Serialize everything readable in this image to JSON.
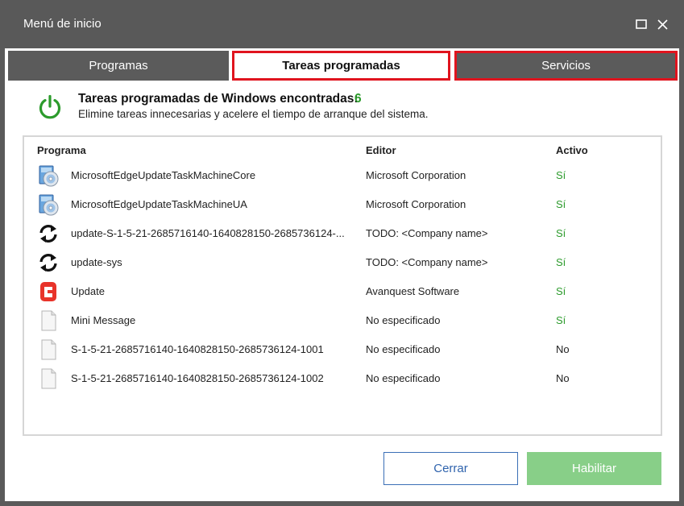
{
  "window": {
    "title": "Menú de inicio"
  },
  "tabs": {
    "programs": "Programas",
    "tasks": "Tareas programadas",
    "services": "Servicios"
  },
  "header": {
    "title": "Tareas programadas de Windows encontradas:",
    "count": "6",
    "subtitle": "Elimine tareas innecesarias y acelere el tiempo de arranque del sistema."
  },
  "columns": {
    "program": "Programa",
    "editor": "Editor",
    "active": "Activo"
  },
  "rows": [
    {
      "icon": "cd-installer-icon",
      "name": "MicrosoftEdgeUpdateTaskMachineCore",
      "editor": "Microsoft Corporation",
      "active": "Sí"
    },
    {
      "icon": "cd-installer-icon",
      "name": "MicrosoftEdgeUpdateTaskMachineUA",
      "editor": "Microsoft Corporation",
      "active": "Sí"
    },
    {
      "icon": "sync-arrows-icon",
      "name": "update-S-1-5-21-2685716140-1640828150-2685736124-...",
      "editor": "TODO: <Company name>",
      "active": "Sí"
    },
    {
      "icon": "sync-arrows-icon",
      "name": "update-sys",
      "editor": "TODO: <Company name>",
      "active": "Sí"
    },
    {
      "icon": "avanquest-logo-icon",
      "name": "Update",
      "editor": "Avanquest Software",
      "active": "Sí"
    },
    {
      "icon": "blank-file-icon",
      "name": "Mini Message",
      "editor": "No especificado",
      "active": "Sí"
    },
    {
      "icon": "blank-file-icon",
      "name": "S-1-5-21-2685716140-1640828150-2685736124-1001",
      "editor": "No especificado",
      "active": "No"
    },
    {
      "icon": "blank-file-icon",
      "name": "S-1-5-21-2685716140-1640828150-2685736124-1002",
      "editor": "No especificado",
      "active": "No"
    }
  ],
  "buttons": {
    "close": "Cerrar",
    "enable": "Habilitar"
  },
  "colors": {
    "accent_red": "#e0141e",
    "success_green": "#2c9b2c",
    "primary_blue": "#2f63ad",
    "disabled_green": "#88cf88",
    "titlebar": "#595959"
  }
}
